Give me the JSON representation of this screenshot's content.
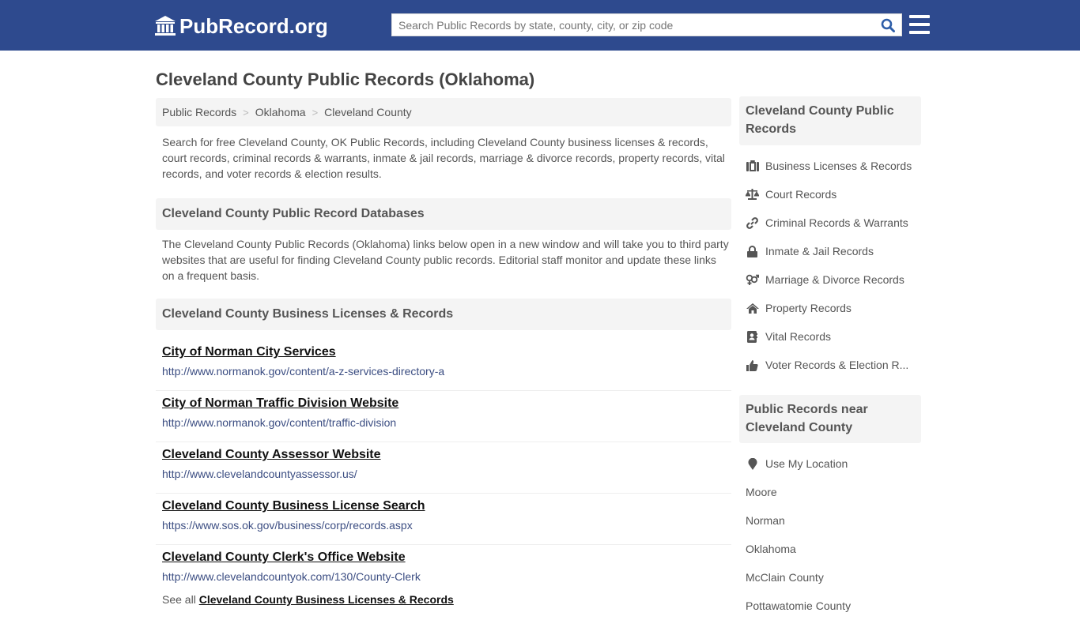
{
  "header": {
    "logo_text": "PubRecord.org",
    "search_placeholder": "Search Public Records by state, county, city, or zip code",
    "brand_color": "#2e4a8e"
  },
  "main": {
    "title": "Cleveland County Public Records (Oklahoma)",
    "breadcrumb": [
      "Public Records",
      "Oklahoma",
      "Cleveland County"
    ],
    "intro": "Search for free Cleveland County, OK Public Records, including Cleveland County business licenses & records, court records, criminal records & warrants, inmate & jail records, marriage & divorce records, property records, vital records, and voter records & election results.",
    "databases_heading": "Cleveland County Public Record Databases",
    "databases_text": "The Cleveland County Public Records (Oklahoma) links below open in a new window and will take you to third party websites that are useful for finding Cleveland County public records. Editorial staff monitor and update these links on a frequent basis.",
    "business_heading": "Cleveland County Business Licenses & Records",
    "links": [
      {
        "title": "City of Norman City Services",
        "url": "http://www.normanok.gov/content/a-z-services-directory-a"
      },
      {
        "title": "City of Norman Traffic Division Website",
        "url": "http://www.normanok.gov/content/traffic-division"
      },
      {
        "title": "Cleveland County Assessor Website",
        "url": "http://www.clevelandcountyassessor.us/"
      },
      {
        "title": "Cleveland County Business License Search",
        "url": "https://www.sos.ok.gov/business/corp/records.aspx"
      },
      {
        "title": "Cleveland County Clerk's Office Website",
        "url": "http://www.clevelandcountyok.com/130/County-Clerk"
      }
    ],
    "see_all_prefix": "See all",
    "see_all_link": "Cleveland County Business Licenses & Records"
  },
  "sidebar": {
    "records_heading": "Cleveland County Public Records",
    "records": [
      {
        "label": "Business Licenses & Records",
        "icon": "briefcase-icon"
      },
      {
        "label": "Court Records",
        "icon": "balance-scale-icon"
      },
      {
        "label": "Criminal Records & Warrants",
        "icon": "link-icon"
      },
      {
        "label": "Inmate & Jail Records",
        "icon": "lock-icon"
      },
      {
        "label": "Marriage & Divorce Records",
        "icon": "venus-mars-icon"
      },
      {
        "label": "Property Records",
        "icon": "home-icon"
      },
      {
        "label": "Vital Records",
        "icon": "address-book-icon"
      },
      {
        "label": "Voter Records & Election R...",
        "icon": "thumbs-up-icon"
      }
    ],
    "nearby_heading": "Public Records near Cleveland County",
    "use_location": "Use My Location",
    "nearby": [
      "Moore",
      "Norman",
      "Oklahoma",
      "McClain County",
      "Pottawatomie County"
    ]
  }
}
